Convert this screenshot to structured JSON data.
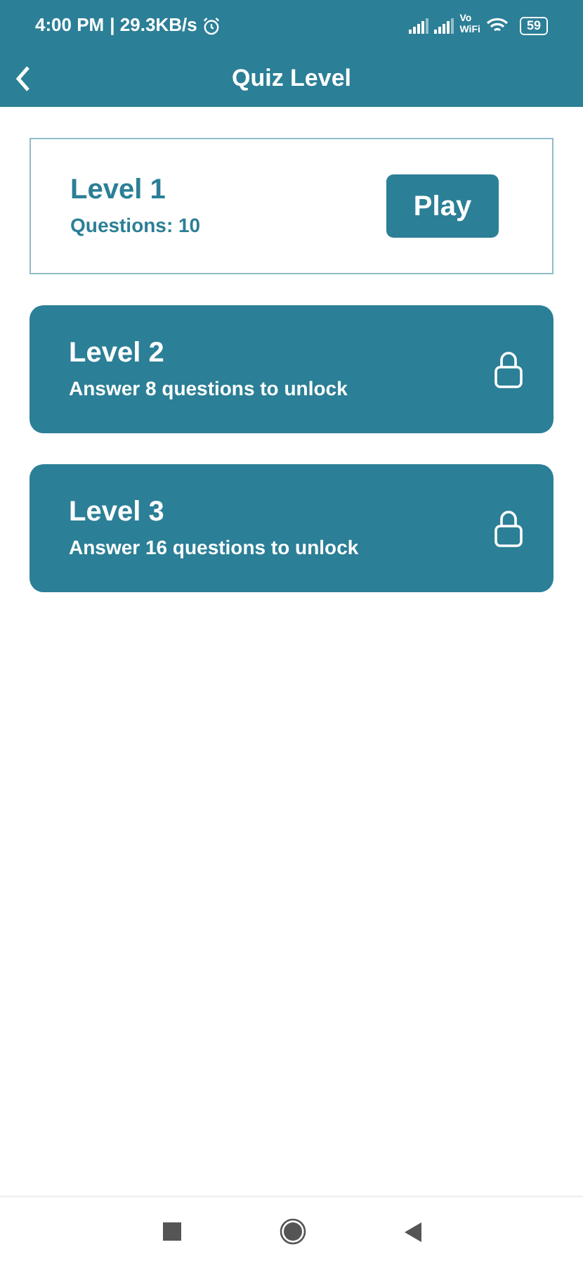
{
  "status_bar": {
    "time": "4:00 PM",
    "speed": "| 29.3KB/s",
    "vowifi": [
      "Vo",
      "WiFi"
    ],
    "battery": "59"
  },
  "header": {
    "title": "Quiz Level"
  },
  "levels": [
    {
      "title": "Level 1",
      "subtitle": "Questions: 10",
      "locked": false,
      "button": "Play"
    },
    {
      "title": "Level 2",
      "subtitle": "Answer 8 questions to unlock",
      "locked": true
    },
    {
      "title": "Level 3",
      "subtitle": "Answer 16 questions to unlock",
      "locked": true
    }
  ]
}
